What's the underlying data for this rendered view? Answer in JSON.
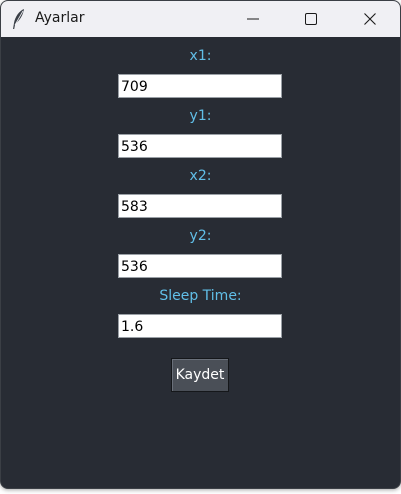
{
  "window": {
    "title": "Ayarlar",
    "icon": "feather-icon",
    "controls": [
      "minimize-icon",
      "maximize-icon",
      "close-icon"
    ]
  },
  "form": {
    "fields": [
      {
        "label": "x1:",
        "value": "709"
      },
      {
        "label": "y1:",
        "value": "536"
      },
      {
        "label": "x2:",
        "value": "583"
      },
      {
        "label": "y2:",
        "value": "536"
      },
      {
        "label": "Sleep Time:",
        "value": "1.6"
      }
    ],
    "save_label": "Kaydet"
  },
  "colors": {
    "background": "#282c34",
    "label": "#61bfe8",
    "titlebar": "#f0f0f4",
    "button": "#4a4f57"
  }
}
